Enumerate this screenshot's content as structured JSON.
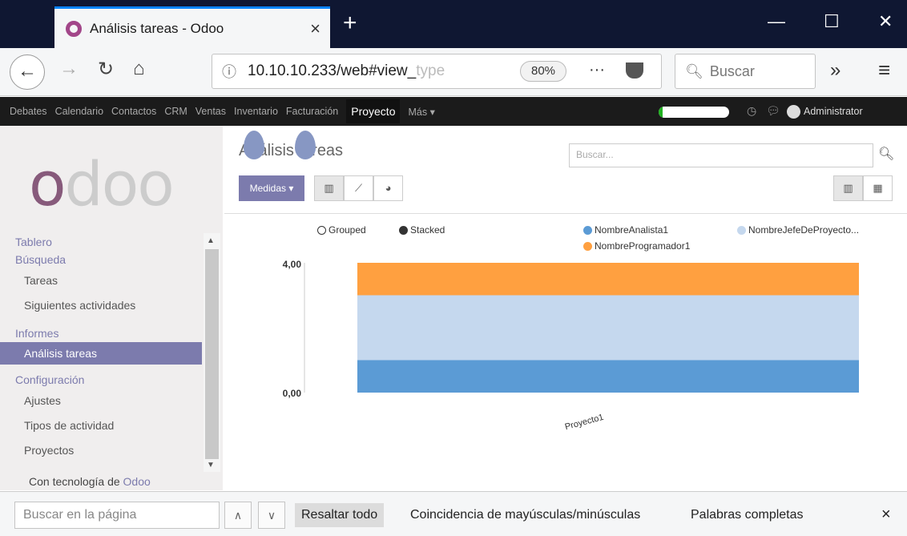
{
  "browser": {
    "tab_title": "Análisis tareas - Odoo",
    "tab_close": "×",
    "new_tab": "+",
    "url_main": "10.10.10.233/web#view_",
    "url_faded": "type",
    "zoom": "80%",
    "url_more": "···",
    "search_placeholder": "Buscar",
    "overflow": "»",
    "menu": "≡"
  },
  "odoo_menu": {
    "items": [
      "Debates",
      "Calendario",
      "Contactos",
      "CRM",
      "Ventas",
      "Inventario",
      "Facturación",
      "Proyecto",
      "Más ▾"
    ],
    "active": "Proyecto",
    "user": "Administrator",
    "progress": 0.06
  },
  "sidebar": {
    "logo": "odoo",
    "sections": [
      {
        "title": "Tablero",
        "items": []
      },
      {
        "title": "Búsqueda",
        "items": [
          "Tareas",
          "Siguientes actividades"
        ]
      },
      {
        "title": "Informes",
        "items": [
          "Análisis tareas"
        ]
      },
      {
        "title": "Configuración",
        "items": [
          "Ajustes",
          "Tipos de actividad",
          "Proyectos"
        ]
      }
    ],
    "active_item": "Análisis tareas",
    "footer_prefix": "Con tecnología de ",
    "footer_brand": "Odoo"
  },
  "control_panel": {
    "breadcrumb": "Análisis tareas",
    "search_placeholder": "Buscar...",
    "measures_button": "Medidas ▾"
  },
  "chart_data": {
    "type": "bar",
    "stacked": true,
    "mode_options": [
      "Grouped",
      "Stacked"
    ],
    "selected_mode": "Stacked",
    "categories": [
      "Proyecto1"
    ],
    "series": [
      {
        "name": "NombreAnalista1",
        "values": [
          1
        ],
        "color": "#5b9bd5"
      },
      {
        "name": "NombreJefeDeProyecto...",
        "values": [
          2
        ],
        "color": "#c5d8ee"
      },
      {
        "name": "NombreProgramador1",
        "values": [
          1
        ],
        "color": "#ffa040"
      }
    ],
    "y_tick_labels": [
      "0,00",
      "4,00"
    ],
    "ylim": [
      0,
      4
    ]
  },
  "findbar": {
    "placeholder": "Buscar en la página",
    "up": "∧",
    "down": "∨",
    "highlight_all": "Resaltar todo",
    "match_case": "Coincidencia de mayúsculas/minúsculas",
    "whole_words": "Palabras completas",
    "close": "×"
  }
}
